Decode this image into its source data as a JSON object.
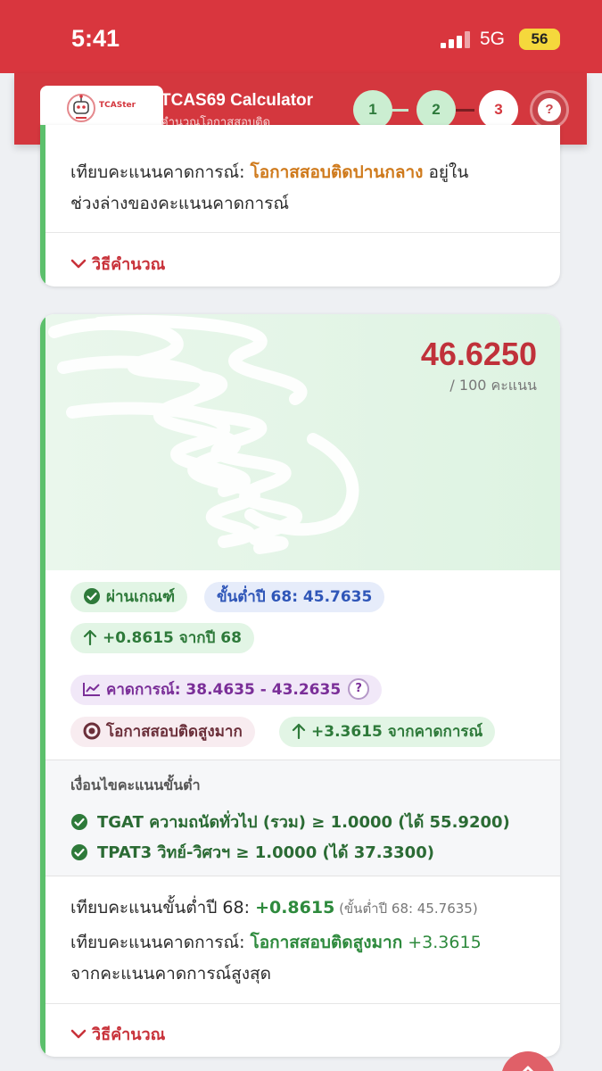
{
  "status_bar": {
    "time": "5:41",
    "network": "5G",
    "battery": "56"
  },
  "header": {
    "logo_text": "TCASter",
    "title": "TCAS69 Calculator",
    "subtitle": "คำนวณโอกาสสอบติด",
    "steps": [
      "1",
      "2",
      "3"
    ],
    "help_label": "?"
  },
  "card_prev": {
    "compare_prefix": "เทียบคะแนนคาดการณ์: ",
    "compare_status": "โอกาสสอบติดปานกลาง",
    "compare_suffix": " อยู่ใน",
    "compare_line2": "ช่วงล่างของคะแนนคาดการณ์",
    "calc_link": "วิธีคำนวณ"
  },
  "card_main": {
    "score": "46.6250",
    "score_max": "/ 100 คะแนน",
    "badges": {
      "pass": "ผ่านเกณฑ์",
      "min_last_year": "ขั้นต่ำปี 68: 45.7635",
      "diff_last_year": "+0.8615 จากปี 68",
      "predicted": "คาดการณ์: 38.4635 - 43.2635",
      "predicted_help": "?",
      "chance": "โอกาสสอบติดสูงมาก",
      "diff_predicted": "+3.3615 จากคาดการณ์"
    },
    "conditions": {
      "title": "เงื่อนไขคะแนนขั้นต่ำ",
      "items": [
        "TGAT ความถนัดทั่วไป (รวม) ≥ 1.0000 (ได้ 55.9200)",
        "TPAT3 วิทย์-วิศวฯ ≥ 1.0000 (ได้ 37.3300)"
      ]
    },
    "compare_min": {
      "prefix": "เทียบคะแนนขั้นต่ำปี 68: ",
      "value": "+0.8615",
      "note": " (ขั้นต่ำปี 68: 45.7635)"
    },
    "compare_predicted": {
      "prefix": "เทียบคะแนนคาดการณ์: ",
      "status": "โอกาสสอบติดสูงมาก",
      "value": " +3.3615",
      "line2": "จากคะแนนคาดการณ์สูงสุด"
    },
    "calc_link": "วิธีคำนวณ"
  },
  "colors": {
    "brand_red": "#d4373e",
    "accent_green": "#5cc06c",
    "score_red": "#c0313a",
    "status_orange": "#cf7a1c"
  }
}
